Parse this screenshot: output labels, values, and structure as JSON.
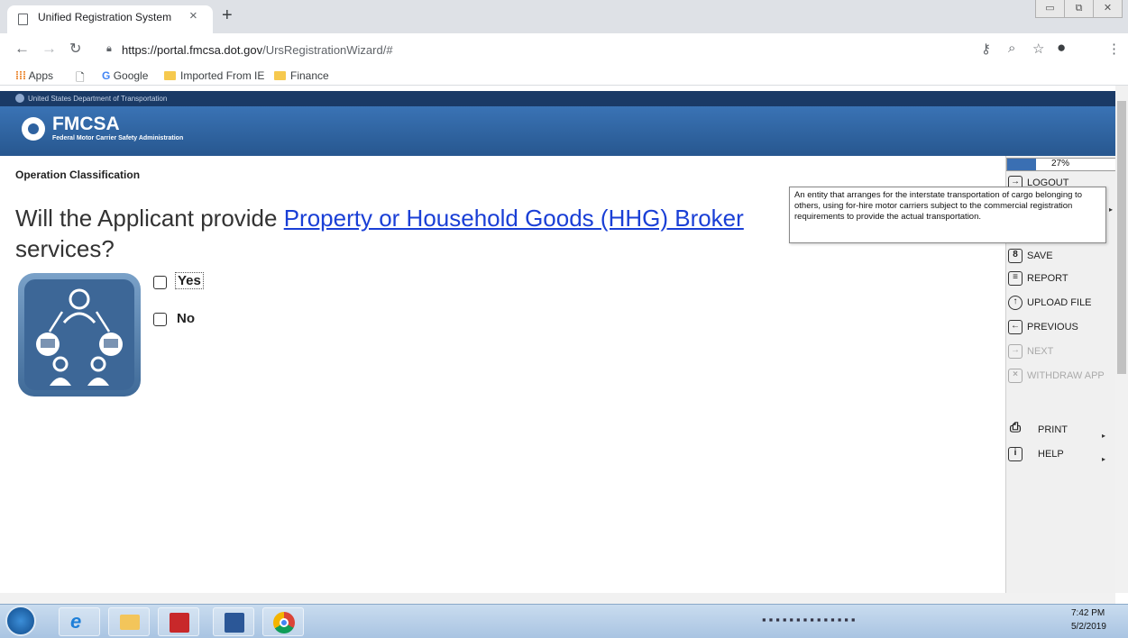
{
  "browser": {
    "tab_title": "Unified Registration System",
    "tab_close": "×",
    "new_tab": "+",
    "url_host": "https://portal.fmcsa.dot.gov",
    "url_path": "/UrsRegistrationWizard/#",
    "bookmarks": [
      "Apps",
      "Google",
      "Imported From IE",
      "Finance"
    ]
  },
  "site": {
    "gov_bar": "United States Department of Transportation",
    "logo_title": "FMCSA",
    "logo_subtitle": "Federal Motor Carrier Safety Administration"
  },
  "page": {
    "section_title": "Operation Classification",
    "question_prefix": "Will the Applicant provide ",
    "question_link": "Property or Household Goods (HHG) Broker",
    "question_suffix": "services?",
    "options": [
      "Yes",
      "No"
    ]
  },
  "tooltip": {
    "text": "An entity that arranges for the interstate transportation of cargo belonging to others, using for-hire motor carriers subject to the commercial registration requirements to provide the actual transportation."
  },
  "panel": {
    "progress_label": "27%",
    "progress_value": 0.27,
    "menu": {
      "logout": "LOGOUT",
      "save": "SAVE",
      "report": "REPORT",
      "upload": "UPLOAD FILE",
      "previous": "PREVIOUS",
      "next": "NEXT",
      "withdraw": "WITHDRAW APP",
      "print": "PRINT",
      "help": "HELP"
    }
  },
  "taskbar": {
    "time": "7:42 PM",
    "date": "5/2/2019"
  }
}
